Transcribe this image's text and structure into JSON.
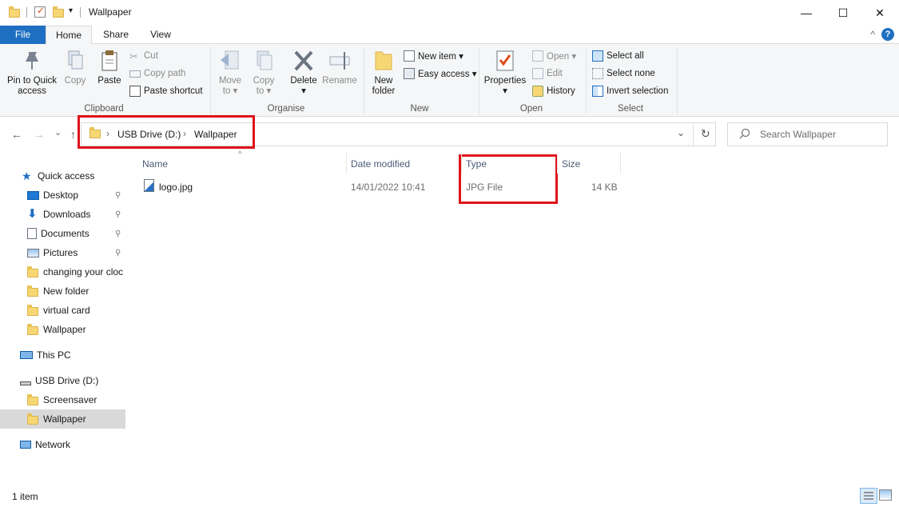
{
  "window": {
    "title": "Wallpaper",
    "minimize": "—",
    "maximize": "☐",
    "close": "✕"
  },
  "tabs": {
    "file": "File",
    "home": "Home",
    "share": "Share",
    "view": "View",
    "help": "?",
    "collapse": "^"
  },
  "ribbon": {
    "clipboard": {
      "label": "Clipboard",
      "pin": "Pin to Quick\naccess",
      "copy": "Copy",
      "paste": "Paste",
      "cut": "Cut",
      "copy_path": "Copy path",
      "paste_shortcut": "Paste shortcut"
    },
    "organise": {
      "label": "Organise",
      "move_to": "Move\nto ▾",
      "copy_to": "Copy\nto ▾",
      "delete": "Delete\n▾",
      "rename": "Rename"
    },
    "new": {
      "label": "New",
      "new_folder": "New\nfolder",
      "new_item": "New item ▾",
      "easy_access": "Easy access ▾"
    },
    "open": {
      "label": "Open",
      "properties": "Properties\n▾",
      "open": "Open ▾",
      "edit": "Edit",
      "history": "History"
    },
    "select": {
      "label": "Select",
      "select_all": "Select all",
      "select_none": "Select none",
      "invert": "Invert selection"
    }
  },
  "navigation": {
    "back": "←",
    "forward": "→",
    "recent": "⌄",
    "up": "↑",
    "breadcrumb": [
      "USB Drive (D:)",
      "Wallpaper"
    ],
    "chevron": "›",
    "dropdown": "⌄",
    "refresh": "↻",
    "search_placeholder": "Search Wallpaper"
  },
  "sidebar": {
    "quick_access": "Quick access",
    "items": [
      {
        "label": "Desktop",
        "pinned": true
      },
      {
        "label": "Downloads",
        "pinned": true
      },
      {
        "label": "Documents",
        "pinned": true
      },
      {
        "label": "Pictures",
        "pinned": true
      },
      {
        "label": "changing your cloc"
      },
      {
        "label": "New folder"
      },
      {
        "label": "virtual card"
      },
      {
        "label": "Wallpaper"
      }
    ],
    "this_pc": "This PC",
    "usb_drive": "USB Drive (D:)",
    "usb_items": [
      "Screensaver",
      "Wallpaper"
    ],
    "network": "Network",
    "pin_glyph": "📌"
  },
  "file_list": {
    "columns": [
      "Name",
      "Date modified",
      "Type",
      "Size"
    ],
    "sort_indicator": "^",
    "rows": [
      {
        "name": "logo.jpg",
        "date": "14/01/2022 10:41",
        "type": "JPG File",
        "size": "14 KB"
      }
    ]
  },
  "status": {
    "count": "1 item"
  },
  "colors": {
    "accent": "#1e6fc2",
    "highlight": "#e0121b",
    "folder": "#f7d774"
  }
}
